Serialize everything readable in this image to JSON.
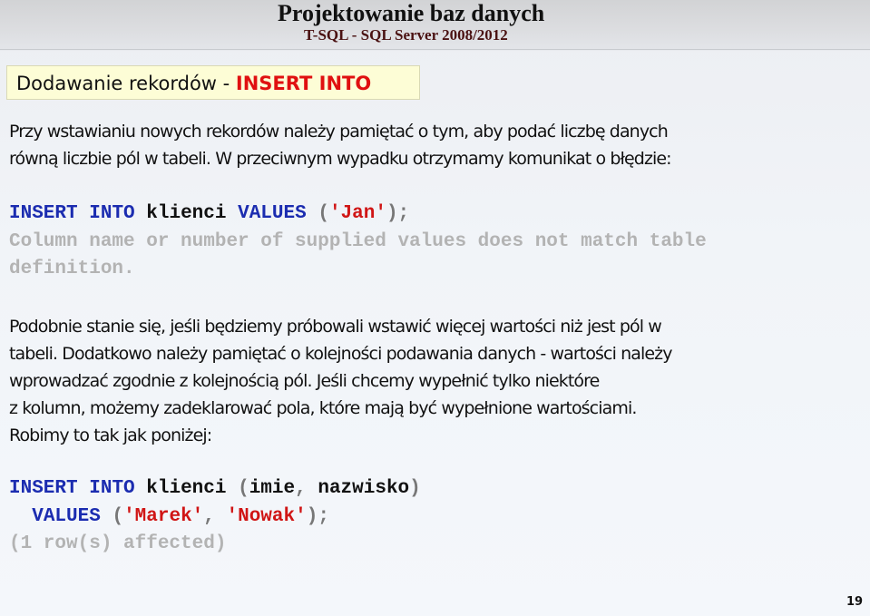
{
  "header": {
    "title": "Projektowanie baz danych",
    "subtitle": "T-SQL - SQL Server 2008/2012"
  },
  "section": {
    "label": "Dodawanie rekordów - ",
    "keyword": "INSERT INTO"
  },
  "paragraph1": {
    "lines": [
      "Przy wstawianiu nowych rekordów należy pamiętać o tym, aby podać liczbę danych",
      "równą liczbie pól w tabeli. W przeciwnym wypadku otrzymamy komunikat o błędzie:"
    ]
  },
  "code1": {
    "kw_insert": "INSERT",
    "kw_into": "INTO",
    "table": "klienci",
    "kw_values": "VALUES",
    "open_paren": "(",
    "value": "'Jan'",
    "close": ");",
    "error_line1": "Column name or number of supplied values does not match table",
    "error_line2": "definition."
  },
  "paragraph2": {
    "lines": [
      "Podobnie stanie się, jeśli będziemy próbowali wstawić więcej wartości niż jest pól w",
      "tabeli. Dodatkowo należy pamiętać o kolejności podawania danych - wartości należy",
      "wprowadzać zgodnie z kolejnością pól. Jeśli chcemy wypełnić tylko niektóre",
      "z kolumn, możemy zadeklarować pola, które mają być wypełnione wartościami.",
      "Robimy to tak jak poniżej:"
    ]
  },
  "code2": {
    "kw_insert": "INSERT",
    "kw_into": "INTO",
    "table": "klienci",
    "open_paren": "(",
    "col1": "imie",
    "comma": ",",
    "col2": "nazwisko",
    "close_paren": ")",
    "indent": "  ",
    "kw_values": "VALUES",
    "open_paren2": "(",
    "val1": "'Marek'",
    "comma2": ",",
    "val2": "'Nowak'",
    "close2": ");",
    "result": "(1 row(s) affected)"
  },
  "footer": {
    "page_number": "19"
  },
  "colors": {
    "keyword": "#1b2cb0",
    "string": "#d01515",
    "message": "#b3b3b3",
    "section_keyword": "#e01010",
    "section_background": "#fdfdd6",
    "subtitle": "#4a1212"
  }
}
